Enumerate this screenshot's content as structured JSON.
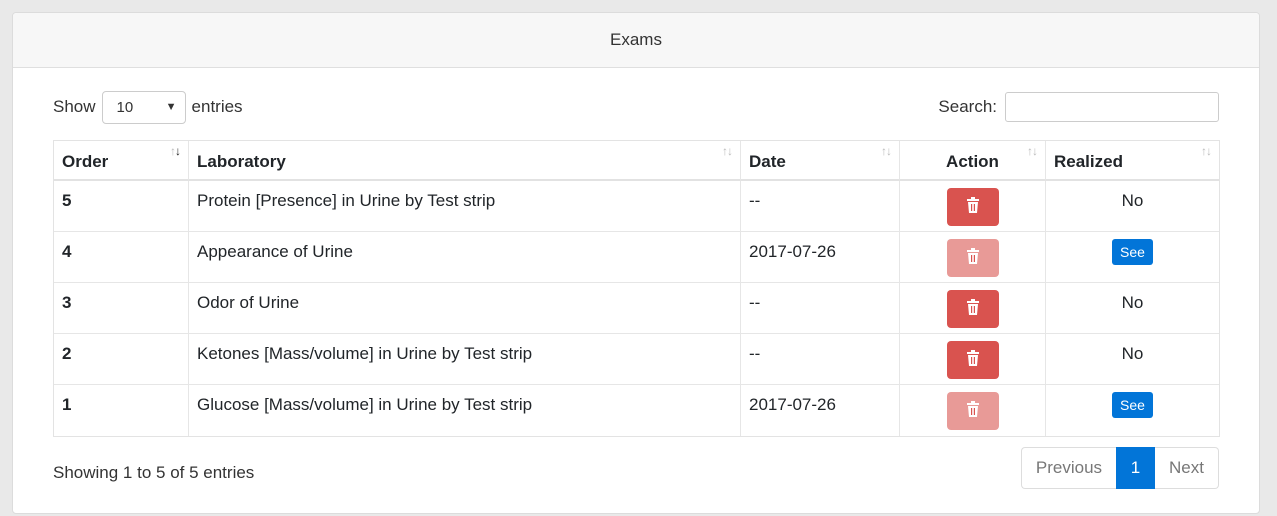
{
  "panel": {
    "title": "Exams"
  },
  "length": {
    "prefix": "Show",
    "value": "10",
    "suffix": "entries"
  },
  "search": {
    "label": "Search:",
    "value": ""
  },
  "table": {
    "columns": [
      "Order",
      "Laboratory",
      "Date",
      "Action",
      "Realized"
    ],
    "rows": [
      {
        "order": "5",
        "laboratory": "Protein [Presence] in Urine by Test strip",
        "date": "--",
        "action_enabled": true,
        "realized": "No"
      },
      {
        "order": "4",
        "laboratory": "Appearance of Urine",
        "date": "2017-07-26",
        "action_enabled": false,
        "realized": "See"
      },
      {
        "order": "3",
        "laboratory": "Odor of Urine",
        "date": "--",
        "action_enabled": true,
        "realized": "No"
      },
      {
        "order": "2",
        "laboratory": "Ketones [Mass/volume] in Urine by Test strip",
        "date": "--",
        "action_enabled": true,
        "realized": "No"
      },
      {
        "order": "1",
        "laboratory": "Glucose [Mass/volume] in Urine by Test strip",
        "date": "2017-07-26",
        "action_enabled": false,
        "realized": "See"
      }
    ]
  },
  "info": "Showing 1 to 5 of 5 entries",
  "pagination": {
    "previous": "Previous",
    "current": "1",
    "next": "Next"
  },
  "colors": {
    "danger": "#d9534f",
    "danger_disabled": "#e89a97",
    "primary": "#0275d8"
  },
  "icons": {
    "action": "trash-icon",
    "sort": "sort-icon"
  }
}
